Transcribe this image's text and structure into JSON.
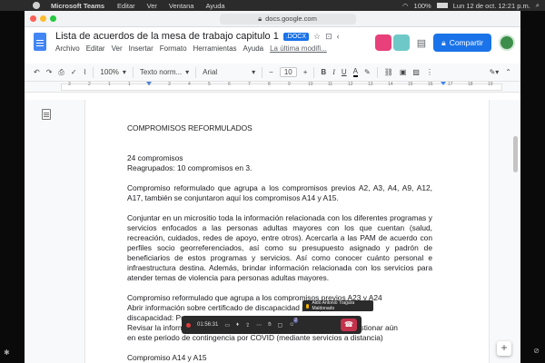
{
  "menubar": {
    "app": "Microsoft Teams",
    "items": [
      "Editar",
      "Ver",
      "Ventana",
      "Ayuda"
    ],
    "battery": "100%",
    "clock": "Lun 12 de oct. 12:21 p.m."
  },
  "browser": {
    "url": "docs.google.com"
  },
  "doc": {
    "title": "Lista de acuerdos de la mesa de trabajo capitulo 1",
    "badge": ".DOCX",
    "menus": [
      "Archivo",
      "Editar",
      "Ver",
      "Insertar",
      "Formato",
      "Herramientas",
      "Ayuda"
    ],
    "last_edit": "La última modifi..."
  },
  "header": {
    "share_label": "Compartir"
  },
  "toolbar": {
    "zoom": "100%",
    "style": "Texto norm...",
    "font": "Arial",
    "size": "10",
    "bold": "B",
    "italic": "I",
    "underline": "U",
    "text_color": "A"
  },
  "ruler": {
    "numbers": [
      "3",
      "2",
      "1",
      "1",
      "2",
      "3",
      "4",
      "5",
      "6",
      "7",
      "8",
      "9",
      "10",
      "11",
      "12",
      "13",
      "14",
      "15",
      "16",
      "17",
      "18",
      "19"
    ]
  },
  "content": {
    "heading": "COMPROMISOS REFORMULADOS",
    "count_line": "24 compromisos",
    "grouped_line": "Reagrupados: 10 compromisos en 3.",
    "para1": "Compromiso reformulado que agrupa a los compromisos previos A2, A3, A4, A9, A12, A17, también se conjuntaron aquí los compromisos A14 y A15.",
    "para2": "Conjuntar en un micrositio toda la información relacionada con los diferentes programas y servicios enfocados a las personas adultas mayores con los que cuentan (salud, recreación, cuidados, redes de apoyo, entre otros). Acercarla a las PAM de acuerdo con perfiles socio georreferenciados, así como su presupuesto asignado y padrón de beneficiarios de estos programas y servicios. Así como conocer cuánto personal e infraestructura destina. Además, brindar información relacionada con los servicios para atender temas de violencia para personas adultas mayores.",
    "para3_l1": "Compromiso reformulado que agrupa a los compromisos previos A23 y A24",
    "para3_l2": "Abrir información sobre certificado de discapacidad para personas con",
    "para3_l3": "discapacidad: Proceso",
    "para3_l4": "Revisar la información sobre el proceso y gestiones que se pueda gestionar aún",
    "para3_l5": "en este periodo de contingencia por COVID (mediante servicios a distancia)",
    "para4": "Compromiso A14 y A15"
  },
  "teams": {
    "timer": "01:56:31",
    "participant_badge": "2",
    "tooltip": "Aldo Antonio Tragara Maldonado"
  },
  "colors": {
    "accent": "#1a73e8",
    "hangup": "#c4314b",
    "rec": "#e03c3c"
  }
}
